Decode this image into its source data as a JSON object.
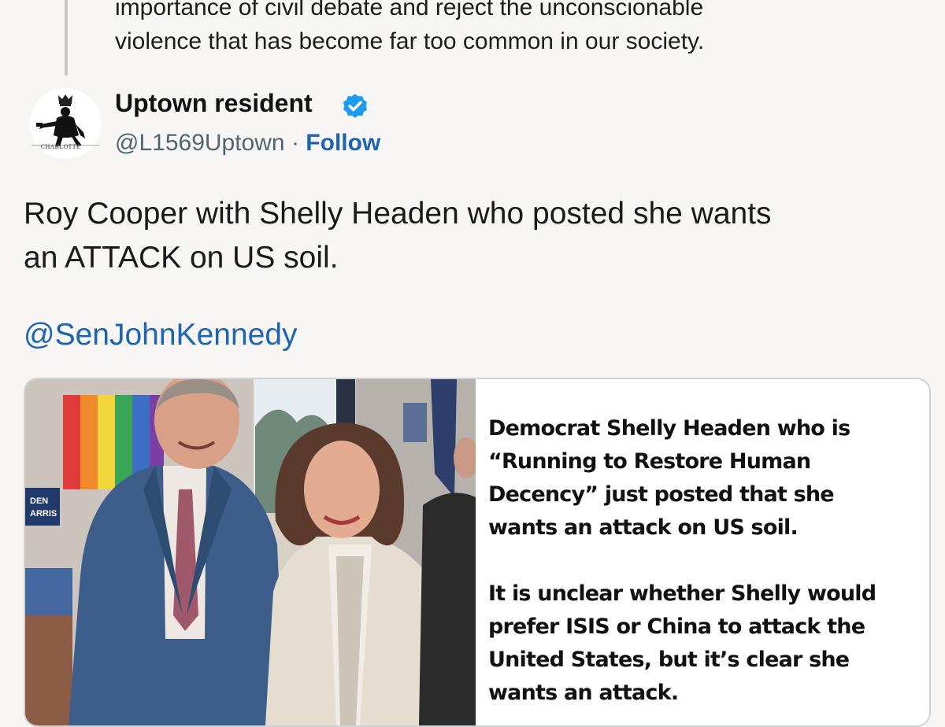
{
  "quoted_tweet": {
    "lines": [
      "importance of civil debate and reject the unconscionable",
      "violence that has become far too common in our society."
    ]
  },
  "author": {
    "display_name": "Uptown resident",
    "handle": "@L1569Uptown",
    "separator": "·",
    "follow_label": "Follow",
    "avatar_text": "CHARLOTTE",
    "verified": true,
    "verified_color": "#1d9bf0"
  },
  "tweet": {
    "text_lines": [
      "Roy Cooper with Shelly Headen who posted she wants",
      "an ATTACK on US soil."
    ],
    "mention": "@SenJohnKennedy"
  },
  "media": {
    "photo_sign_text": [
      "DEN",
      "ARRIS"
    ],
    "caption_paragraphs": [
      [
        "Democrat Shelly Headen who is",
        "“Running to Restore Human",
        "Decency” just posted that she",
        "wants an attack on US soil."
      ],
      [
        "It is unclear whether Shelly would",
        "prefer ISIS or China to attack the",
        "United States, but it’s clear she",
        "wants an attack."
      ]
    ]
  },
  "colors": {
    "link": "#1d64b2",
    "background": "#f7f6f4",
    "secondary_text": "#536471"
  }
}
